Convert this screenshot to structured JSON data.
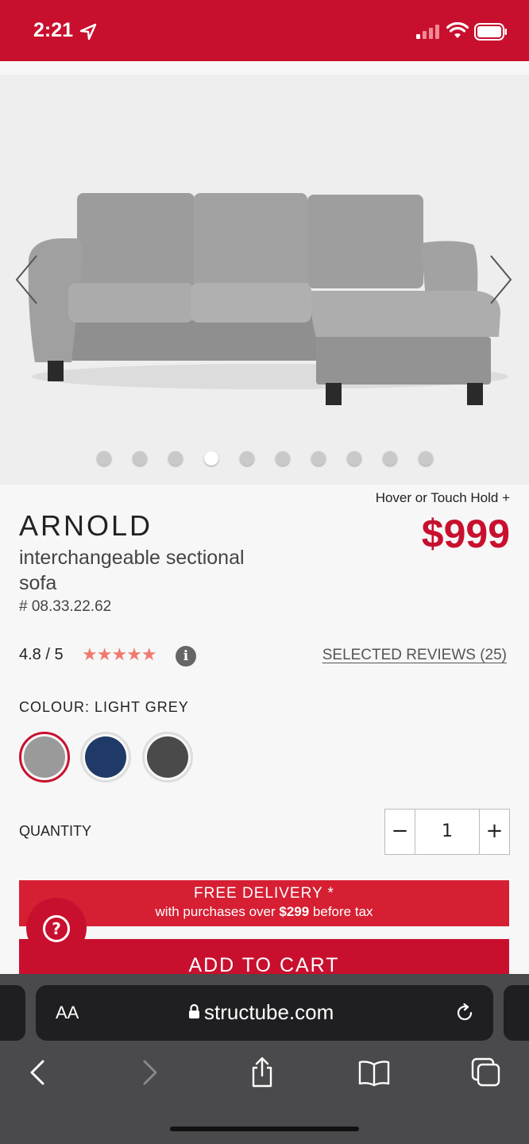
{
  "status_bar": {
    "time": "2:21"
  },
  "product": {
    "hover_hint": "Hover or Touch Hold +",
    "name": "ARNOLD",
    "price": "$999",
    "subtitle": "interchangeable sectional sofa",
    "sku": "# 08.33.22.62",
    "rating": "4.8 / 5",
    "stars": "★★★★★",
    "reviews_link": "SELECTED REVIEWS (25)",
    "colour_label": "COLOUR: LIGHT GREY",
    "swatches": [
      "#9a9a9a",
      "#1f3a66",
      "#4a4a4a"
    ],
    "quantity_label": "QUANTITY",
    "quantity": "1",
    "minus": "−",
    "plus": "+"
  },
  "gallery": {
    "dot_count": 10,
    "active_index": 3
  },
  "delivery": {
    "line1": "FREE DELIVERY *",
    "line2_pre": "with purchases over ",
    "line2_amount": "$299",
    "line2_post": " before tax"
  },
  "help": {
    "label": "?"
  },
  "cart": {
    "label": "ADD TO CART"
  },
  "browser": {
    "aa": "AA",
    "url": "structube.com"
  },
  "colors": {
    "brand_red": "#c8102e",
    "star": "#ef7b6f"
  }
}
